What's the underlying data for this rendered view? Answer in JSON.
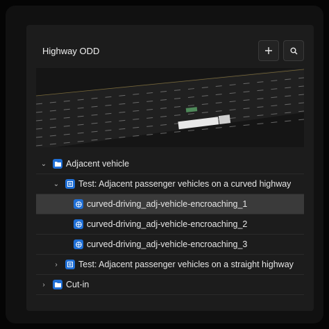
{
  "panel": {
    "title": "Highway ODD",
    "add_icon": "plus-icon",
    "search_icon": "search-icon"
  },
  "tree": {
    "folder1": {
      "label": "Adjacent vehicle",
      "expanded": true,
      "icon": "folder-icon"
    },
    "test1": {
      "label": "Test: Adjacent passenger vehicles on a curved highway",
      "expanded": true,
      "icon": "test-icon"
    },
    "scenarios": [
      {
        "label": "curved-driving_adj-vehicle-encroaching_1",
        "icon": "globe-icon",
        "selected": true
      },
      {
        "label": "curved-driving_adj-vehicle-encroaching_2",
        "icon": "globe-icon",
        "selected": false
      },
      {
        "label": "curved-driving_adj-vehicle-encroaching_3",
        "icon": "globe-icon",
        "selected": false
      }
    ],
    "test2": {
      "label": "Test: Adjacent passenger vehicles on a straight highway",
      "expanded": false,
      "icon": "test-icon"
    },
    "folder2": {
      "label": "Cut-in",
      "expanded": false,
      "icon": "folder-icon"
    }
  },
  "colors": {
    "accent": "#1f6fd6",
    "selected_row": "#3a3a3a",
    "panel": "#1c1c1c"
  }
}
